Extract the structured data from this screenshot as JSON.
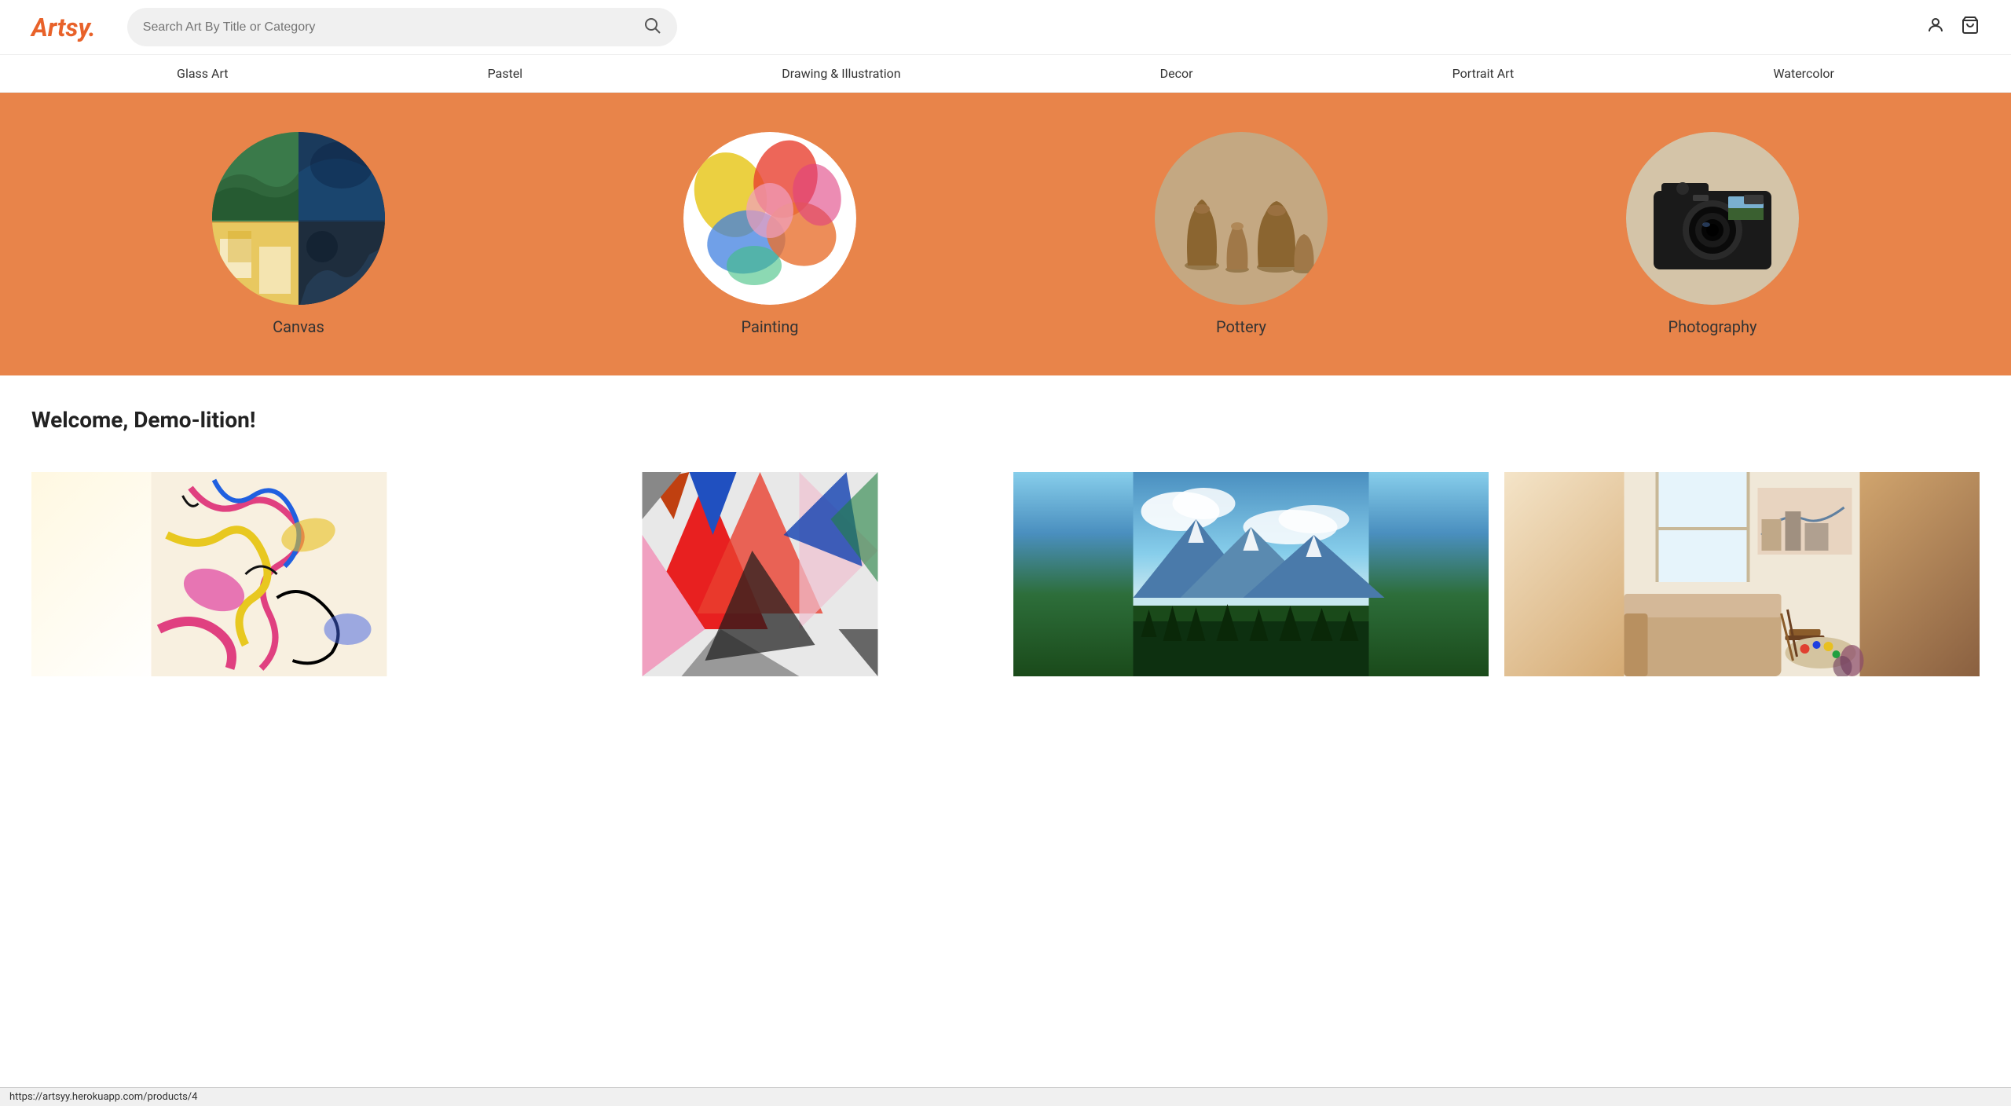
{
  "header": {
    "logo": "Artsy.",
    "search_placeholder": "Search Art By Title or Category"
  },
  "nav": {
    "items": [
      {
        "label": "Glass Art",
        "id": "glass-art"
      },
      {
        "label": "Pastel",
        "id": "pastel"
      },
      {
        "label": "Drawing & Illustration",
        "id": "drawing-illustration"
      },
      {
        "label": "Decor",
        "id": "decor"
      },
      {
        "label": "Portrait Art",
        "id": "portrait-art"
      },
      {
        "label": "Watercolor",
        "id": "watercolor"
      }
    ]
  },
  "hero": {
    "bg_color": "#e8844a",
    "categories": [
      {
        "label": "Canvas",
        "id": "canvas"
      },
      {
        "label": "Painting",
        "id": "painting"
      },
      {
        "label": "Pottery",
        "id": "pottery"
      },
      {
        "label": "Photography",
        "id": "photography"
      }
    ]
  },
  "welcome": {
    "title": "Welcome, Demo-lition!"
  },
  "products": [
    {
      "id": "product-1",
      "type": "abstract"
    },
    {
      "id": "product-2",
      "type": "geometric"
    },
    {
      "id": "product-3",
      "type": "landscape"
    },
    {
      "id": "product-4",
      "type": "studio"
    }
  ],
  "status_bar": {
    "url": "https://artsyy.herokuapp.com/products/4"
  },
  "icons": {
    "search": "🔍",
    "user": "👤",
    "cart": "🛒"
  }
}
